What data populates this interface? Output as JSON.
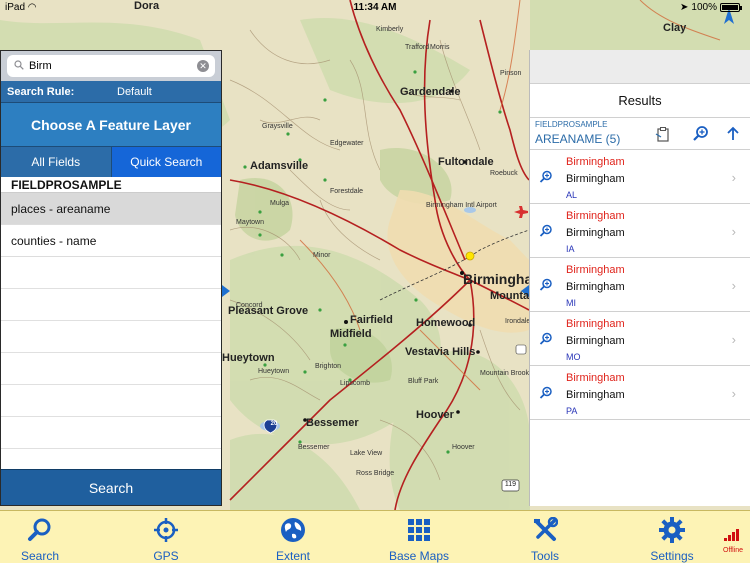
{
  "status_bar": {
    "carrier": "iPad",
    "time": "11:34 AM",
    "battery": "100%"
  },
  "map": {
    "labels": [
      {
        "text": "Dora",
        "cls": "ml-md"
      },
      {
        "text": "Clay",
        "cls": "ml-md"
      },
      {
        "text": "Gardendale",
        "cls": "ml-md"
      },
      {
        "text": "Adamsville",
        "cls": "ml-md"
      },
      {
        "text": "Fultondale",
        "cls": "ml-md"
      },
      {
        "text": "Birmingham Intl Airport",
        "cls": "ml-xs"
      },
      {
        "text": "Birmingham",
        "cls": "ml-lg"
      },
      {
        "text": "Mountain",
        "cls": "ml-md"
      },
      {
        "text": "Pleasant Grove",
        "cls": "ml-md"
      },
      {
        "text": "Fairfield",
        "cls": "ml-md"
      },
      {
        "text": "Midfield",
        "cls": "ml-md"
      },
      {
        "text": "Homewood",
        "cls": "ml-md"
      },
      {
        "text": "Vestavia Hills",
        "cls": "ml-md"
      },
      {
        "text": "Hueytown",
        "cls": "ml-md"
      },
      {
        "text": "Bessemer",
        "cls": "ml-md"
      },
      {
        "text": "Hoover",
        "cls": "ml-md"
      },
      {
        "text": "Graysville",
        "cls": "ml-xs"
      },
      {
        "text": "Forestdale",
        "cls": "ml-xs"
      },
      {
        "text": "Maytown",
        "cls": "ml-xs"
      },
      {
        "text": "Minor",
        "cls": "ml-xs"
      },
      {
        "text": "Concord",
        "cls": "ml-xs"
      },
      {
        "text": "Lipscomb",
        "cls": "ml-xs"
      },
      {
        "text": "Brighton",
        "cls": "ml-xs"
      },
      {
        "text": "Trafford",
        "cls": "ml-xs"
      },
      {
        "text": "Kimberly",
        "cls": "ml-xs"
      },
      {
        "text": "Morris",
        "cls": "ml-xs"
      },
      {
        "text": "Edgewater",
        "cls": "ml-xs"
      },
      {
        "text": "Roebuck",
        "cls": "ml-xs"
      },
      {
        "text": "Irondale",
        "cls": "ml-xs"
      },
      {
        "text": "Mulga",
        "cls": "ml-xs"
      },
      {
        "text": "Lake View",
        "cls": "ml-xs"
      },
      {
        "text": "Pinson",
        "cls": "ml-xs"
      },
      {
        "text": "Hueytown",
        "cls": "ml-xs"
      },
      {
        "text": "Bessemer",
        "cls": "ml-xs"
      },
      {
        "text": "Hoover",
        "cls": "ml-xs"
      },
      {
        "text": "Ross Bridge",
        "cls": "ml-xs"
      },
      {
        "text": "Bluff Park",
        "cls": "ml-xs"
      },
      {
        "text": "Mountain Brook",
        "cls": "ml-xs"
      }
    ],
    "shields": [
      "20",
      "119"
    ]
  },
  "search_panel": {
    "search_value": "Birm",
    "search_rule_label": "Search Rule:",
    "search_rule_value": "Default",
    "choose_layer": "Choose A Feature Layer",
    "tab_all_fields": "All Fields",
    "tab_quick_search": "Quick Search",
    "layer_source": "FIELDPROSAMPLE",
    "layers": [
      "places - areaname",
      "counties - name"
    ],
    "search_button": "Search"
  },
  "results_panel": {
    "title": "Results",
    "source": "FIELDPROSAMPLE",
    "group": "AREANAME (5)",
    "items": [
      {
        "title": "Birmingham",
        "name": "Birmingham",
        "state": "AL"
      },
      {
        "title": "Birmingham",
        "name": "Birmingham",
        "state": "IA"
      },
      {
        "title": "Birmingham",
        "name": "Birmingham",
        "state": "MI"
      },
      {
        "title": "Birmingham",
        "name": "Birmingham",
        "state": "MO"
      },
      {
        "title": "Birmingham",
        "name": "Birmingham",
        "state": "PA"
      }
    ]
  },
  "tabbar": {
    "items": [
      {
        "label": "Search",
        "icon": "search-icon"
      },
      {
        "label": "GPS",
        "icon": "crosshair-icon"
      },
      {
        "label": "Extent",
        "icon": "globe-icon"
      },
      {
        "label": "Base Maps",
        "icon": "grid-icon"
      },
      {
        "label": "Tools",
        "icon": "tools-icon"
      },
      {
        "label": "Settings",
        "icon": "gear-icon"
      }
    ],
    "status": "Offline"
  },
  "colors": {
    "panel_blue": "#2c6ca8",
    "tab_blue": "#1a5fc2",
    "tabbar_bg": "#fdf3b5",
    "result_red": "#e0241c"
  }
}
